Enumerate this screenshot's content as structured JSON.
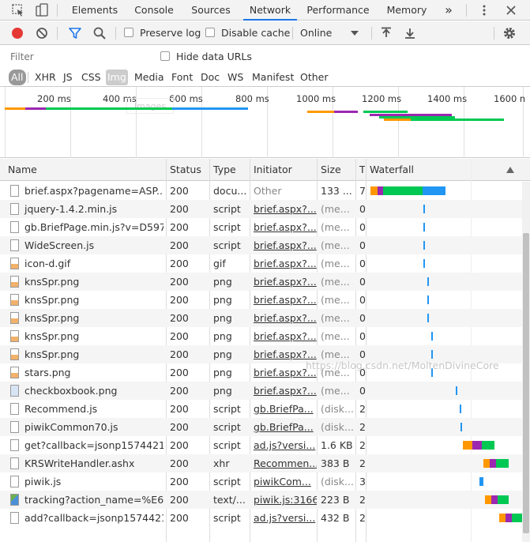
{
  "tabs": [
    "Elements",
    "Console",
    "Sources",
    "Network",
    "Performance",
    "Memory"
  ],
  "tabs_more": "»",
  "toolbar": {
    "preserve_log": "Preserve log",
    "disable_cache": "Disable cache",
    "throttle": "Online"
  },
  "filter": {
    "placeholder": "Filter",
    "hide_data_urls": "Hide data URLs",
    "types": [
      "All",
      "XHR",
      "JS",
      "CSS",
      "Img",
      "Media",
      "Font",
      "Doc",
      "WS",
      "Manifest",
      "Other"
    ]
  },
  "overview": {
    "ticks": [
      "200 ms",
      "400 ms",
      "600 ms",
      "800 ms",
      "1000 ms",
      "1200 ms",
      "1400 ms",
      "1600 n"
    ],
    "ghost_label": "Images"
  },
  "table": {
    "columns": [
      "Name",
      "Status",
      "Type",
      "Initiator",
      "Size",
      "T",
      "Waterfall"
    ],
    "rows": [
      {
        "name": "brief.aspx?pagename=ASP....",
        "status": "200",
        "type": "docu...",
        "initiator": "Other",
        "size": "133 ...",
        "time": "7"
      },
      {
        "name": "jquery-1.4.2.min.js",
        "status": "200",
        "type": "script",
        "initiator": "brief.aspx?...",
        "size": "(me...",
        "time": "0"
      },
      {
        "name": "gb.BriefPage.min.js?v=D597...",
        "status": "200",
        "type": "script",
        "initiator": "brief.aspx?...",
        "size": "(me...",
        "time": "0"
      },
      {
        "name": "WideScreen.js",
        "status": "200",
        "type": "script",
        "initiator": "brief.aspx?...",
        "size": "(me...",
        "time": "0"
      },
      {
        "name": "icon-d.gif",
        "status": "200",
        "type": "gif",
        "initiator": "brief.aspx?...",
        "size": "(me...",
        "time": "0"
      },
      {
        "name": "knsSpr.png",
        "status": "200",
        "type": "png",
        "initiator": "brief.aspx?...",
        "size": "(me...",
        "time": "0"
      },
      {
        "name": "knsSpr.png",
        "status": "200",
        "type": "png",
        "initiator": "brief.aspx?...",
        "size": "(me...",
        "time": "0"
      },
      {
        "name": "knsSpr.png",
        "status": "200",
        "type": "png",
        "initiator": "brief.aspx?...",
        "size": "(me...",
        "time": "0"
      },
      {
        "name": "knsSpr.png",
        "status": "200",
        "type": "png",
        "initiator": "brief.aspx?...",
        "size": "(me...",
        "time": "0"
      },
      {
        "name": "knsSpr.png",
        "status": "200",
        "type": "png",
        "initiator": "brief.aspx?...",
        "size": "(me...",
        "time": "0"
      },
      {
        "name": "stars.png",
        "status": "200",
        "type": "png",
        "initiator": "brief.aspx?...",
        "size": "(me...",
        "time": "0"
      },
      {
        "name": "checkboxbook.png",
        "status": "200",
        "type": "png",
        "initiator": "brief.aspx?...",
        "size": "(me...",
        "time": "0"
      },
      {
        "name": "Recommend.js",
        "status": "200",
        "type": "script",
        "initiator": "gb.BriefPa...",
        "size": "(disk...",
        "time": "2"
      },
      {
        "name": "piwikCommon70.js",
        "status": "200",
        "type": "script",
        "initiator": "gb.BriefPa...",
        "size": "(disk...",
        "time": "2"
      },
      {
        "name": "get?callback=jsonp1574421...",
        "status": "200",
        "type": "script",
        "initiator": "ad.js?versi...",
        "size": "1.6 KB",
        "time": "2"
      },
      {
        "name": "KRSWriteHandler.ashx",
        "status": "200",
        "type": "xhr",
        "initiator": "Recommen...",
        "size": "383 B",
        "time": "2"
      },
      {
        "name": "piwik.js",
        "status": "200",
        "type": "script",
        "initiator": "piwikCom...",
        "size": "(disk...",
        "time": "3"
      },
      {
        "name": "tracking?action_name=%E6...",
        "status": "200",
        "type": "text/...",
        "initiator": "piwik.js:3166",
        "size": "223 B",
        "time": "2"
      },
      {
        "name": "add?callback=jsonp1574421...",
        "status": "200",
        "type": "script",
        "initiator": "ad.js?versi...",
        "size": "432 B",
        "time": "2"
      }
    ]
  },
  "colors": {
    "accent": "#1a73e8",
    "record": "#e53935",
    "waiting": "#00c853",
    "download": "#2196f3",
    "queue": "#ff9800",
    "ssl": "#9c27b0"
  },
  "watermark": "https://blog.csdn.net/MoltenDivineCore"
}
